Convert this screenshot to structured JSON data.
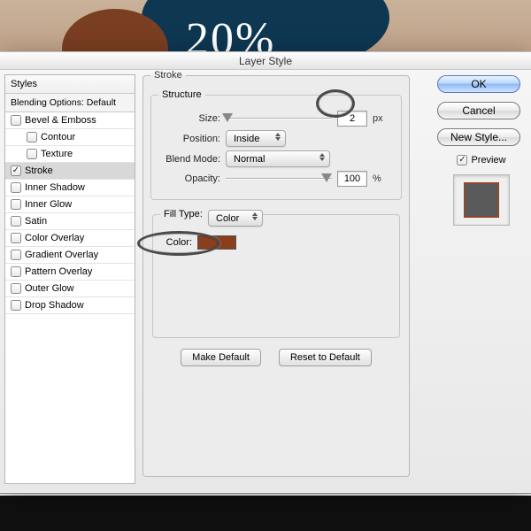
{
  "bg_percent": "20%",
  "dialog": {
    "title": "Layer Style"
  },
  "left": {
    "header": "Styles",
    "subheader": "Blending Options: Default",
    "items": [
      {
        "label": "Bevel & Emboss",
        "checked": false,
        "sub": false
      },
      {
        "label": "Contour",
        "checked": false,
        "sub": true
      },
      {
        "label": "Texture",
        "checked": false,
        "sub": true
      },
      {
        "label": "Stroke",
        "checked": true,
        "sub": false,
        "selected": true
      },
      {
        "label": "Inner Shadow",
        "checked": false,
        "sub": false
      },
      {
        "label": "Inner Glow",
        "checked": false,
        "sub": false
      },
      {
        "label": "Satin",
        "checked": false,
        "sub": false
      },
      {
        "label": "Color Overlay",
        "checked": false,
        "sub": false
      },
      {
        "label": "Gradient Overlay",
        "checked": false,
        "sub": false
      },
      {
        "label": "Pattern Overlay",
        "checked": false,
        "sub": false
      },
      {
        "label": "Outer Glow",
        "checked": false,
        "sub": false
      },
      {
        "label": "Drop Shadow",
        "checked": false,
        "sub": false
      }
    ]
  },
  "stroke": {
    "legend": "Stroke",
    "structure_legend": "Structure",
    "size_label": "Size:",
    "size_value": "2",
    "size_unit": "px",
    "position_label": "Position:",
    "position_value": "Inside",
    "blend_label": "Blend Mode:",
    "blend_value": "Normal",
    "opacity_label": "Opacity:",
    "opacity_value": "100",
    "opacity_unit": "%",
    "filltype_label": "Fill Type:",
    "filltype_value": "Color",
    "color_label": "Color:",
    "color_hex": "#8a3e1b",
    "make_default": "Make Default",
    "reset_default": "Reset to Default"
  },
  "right": {
    "ok": "OK",
    "cancel": "Cancel",
    "newstyle": "New Style...",
    "preview_label": "Preview",
    "preview_checked": true
  }
}
